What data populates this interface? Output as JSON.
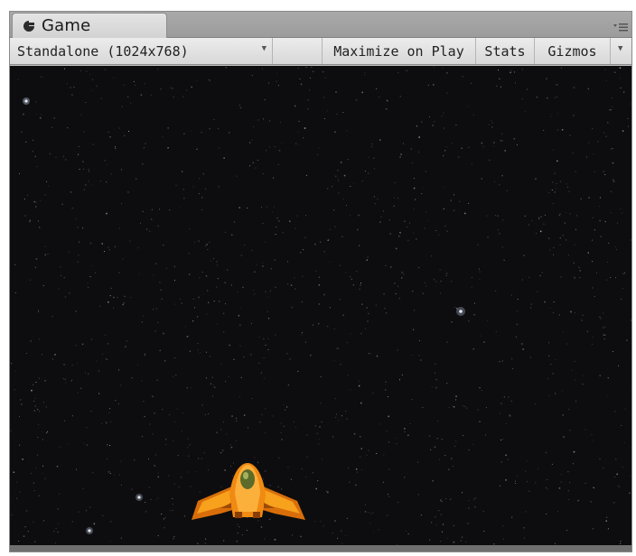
{
  "window": {
    "tab_title": "Game",
    "tab_icon": "game-view-icon"
  },
  "toolbar": {
    "aspect_dropdown": "Standalone (1024x768)",
    "maximize_on_play": "Maximize on Play",
    "stats": "Stats",
    "gizmos": "Gizmos"
  },
  "game": {
    "background_color": "#0d0d0f",
    "player_ship": "orange-spaceship",
    "ship_color": "#f08a12"
  }
}
